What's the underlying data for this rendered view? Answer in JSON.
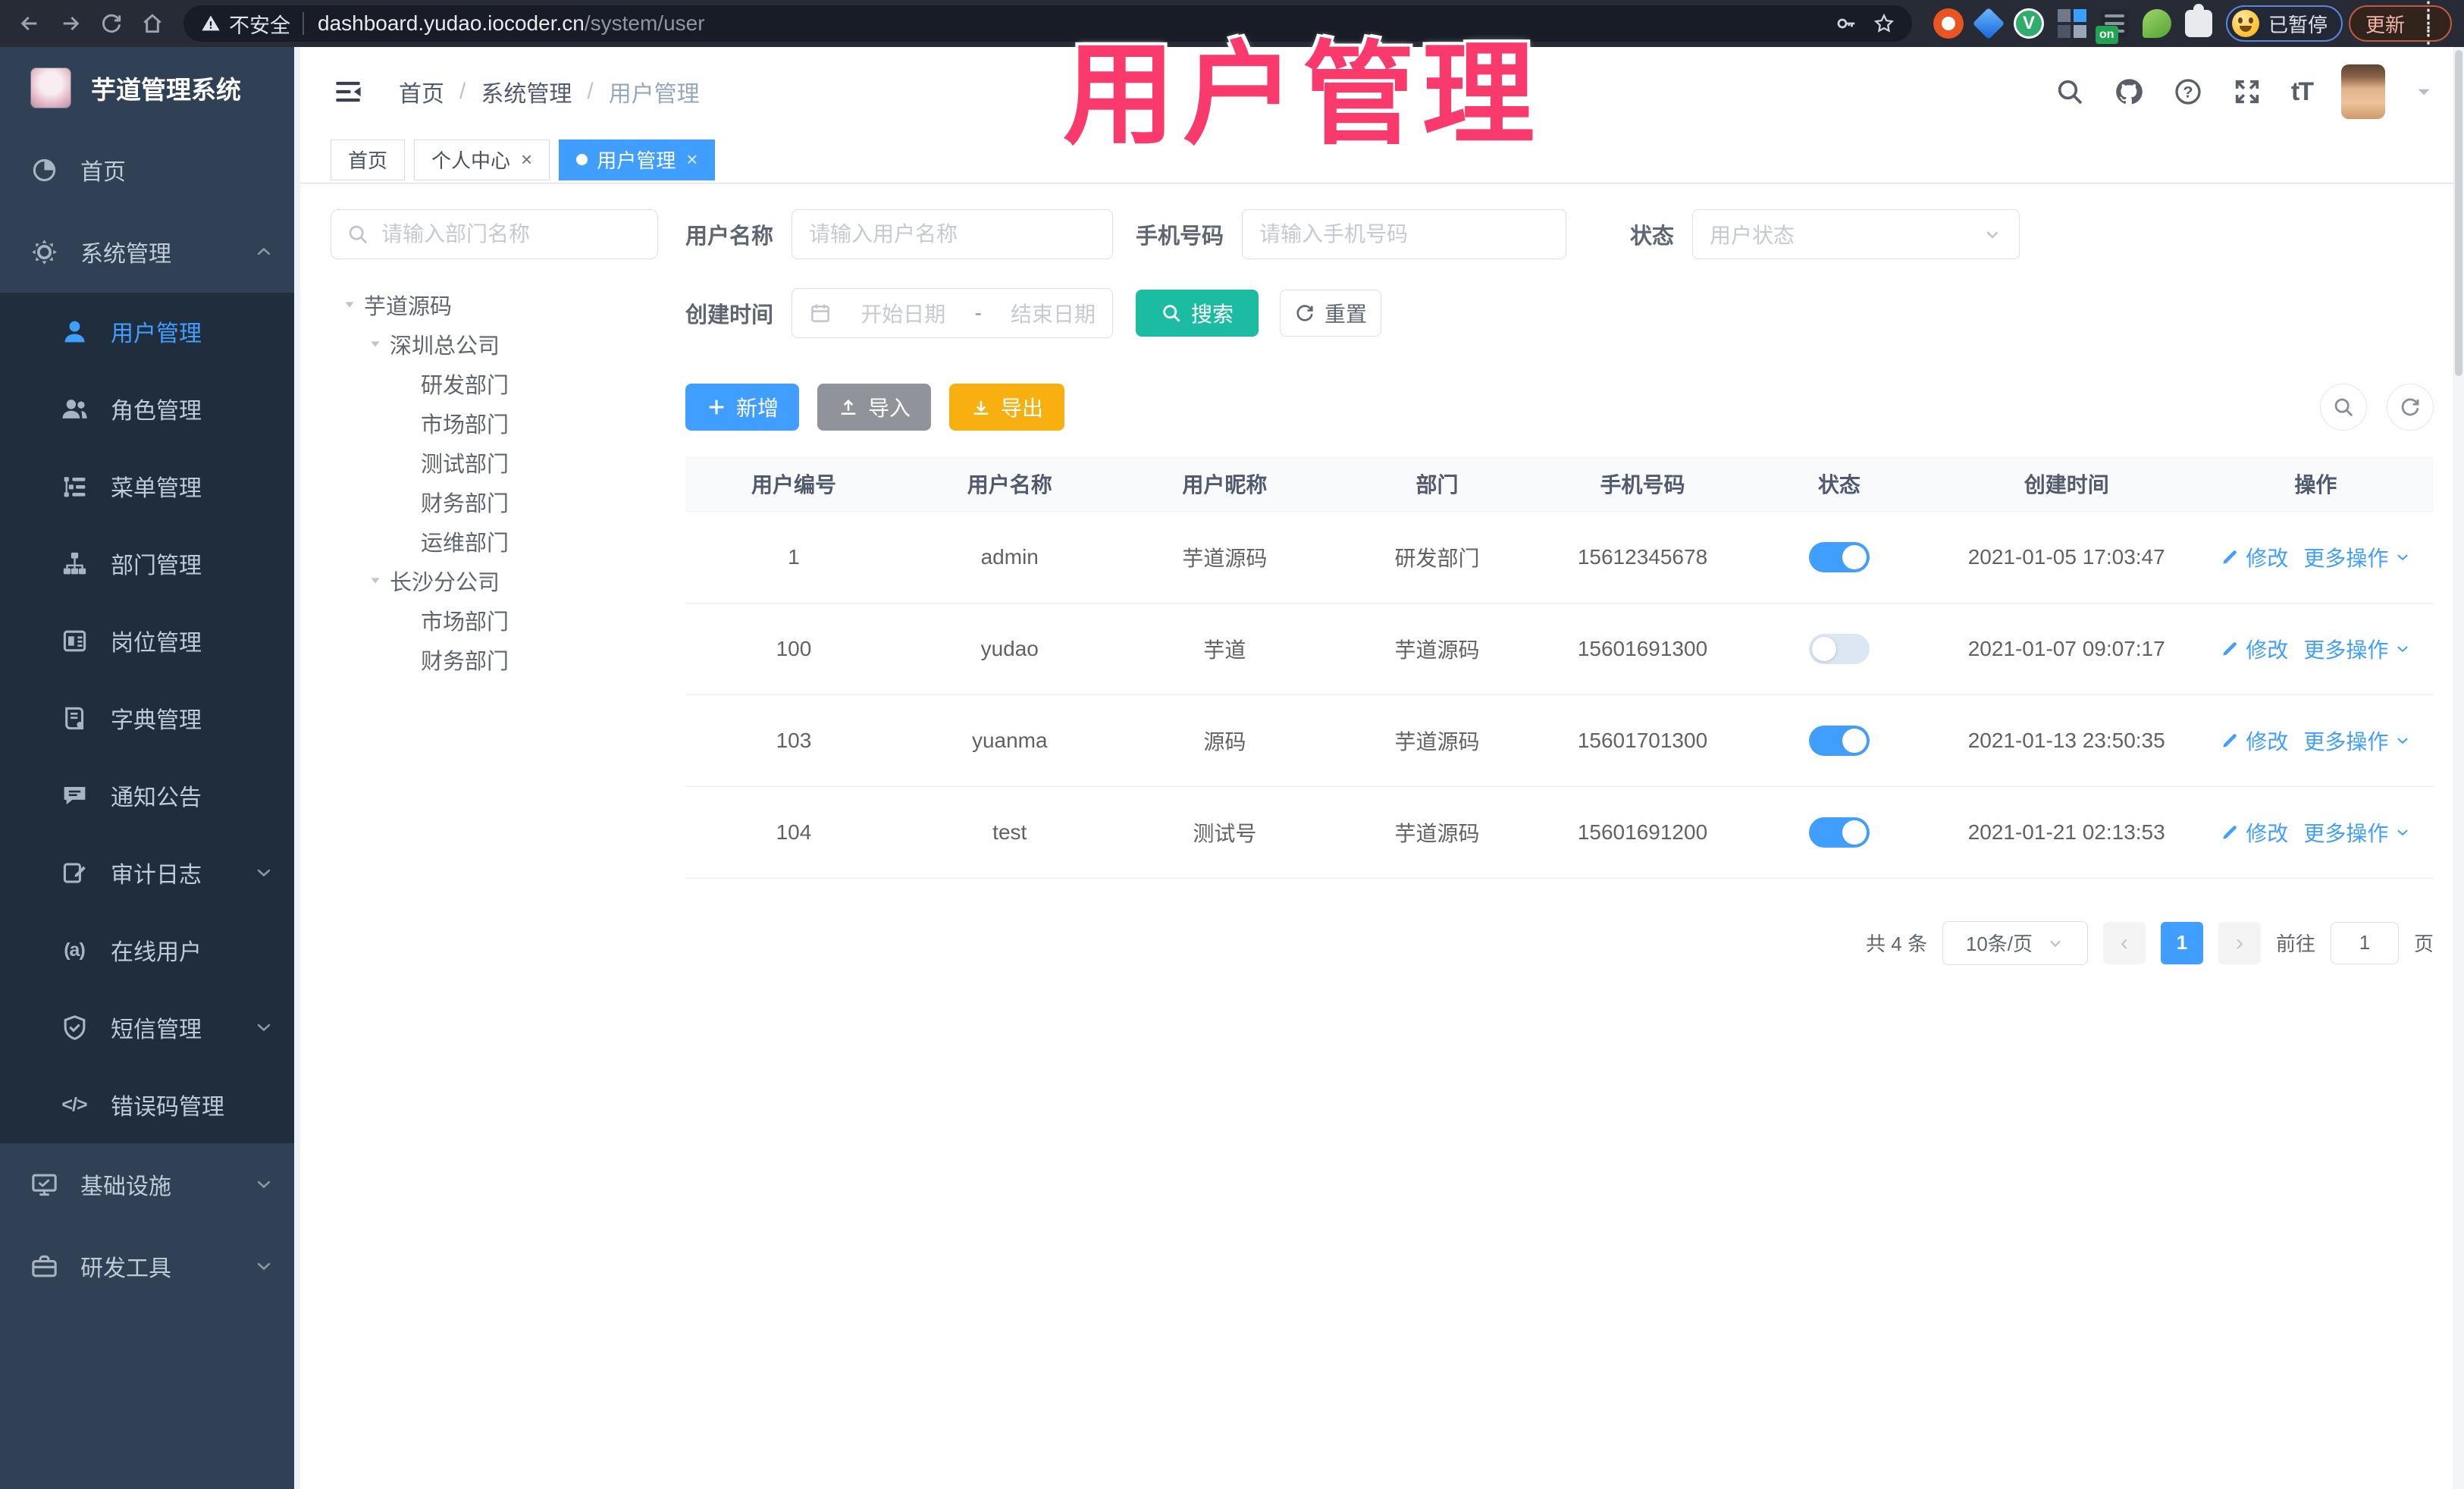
{
  "browser": {
    "security_warning": "不安全",
    "url_host": "dashboard.yudao.iocoder.cn",
    "url_path": "/system/user",
    "vue_badge": "V",
    "on_badge": "on",
    "paused_badge": "已暂停",
    "update_label": "更新"
  },
  "watermark": "用户管理",
  "sidebar": {
    "logo_title": "芋道管理系统",
    "items": [
      {
        "label": "首页",
        "icon": "home-icon",
        "level": "top"
      },
      {
        "label": "系统管理",
        "icon": "gear-icon",
        "level": "top",
        "chevron": "up"
      },
      {
        "label": "用户管理",
        "icon": "user-icon",
        "level": "sub",
        "active": true
      },
      {
        "label": "角色管理",
        "icon": "users-icon",
        "level": "sub"
      },
      {
        "label": "菜单管理",
        "icon": "menu-tree-icon",
        "level": "sub"
      },
      {
        "label": "部门管理",
        "icon": "org-icon",
        "level": "sub"
      },
      {
        "label": "岗位管理",
        "icon": "badge-icon",
        "level": "sub"
      },
      {
        "label": "字典管理",
        "icon": "book-icon",
        "level": "sub"
      },
      {
        "label": "通知公告",
        "icon": "announcement-icon",
        "level": "sub"
      },
      {
        "label": "审计日志",
        "icon": "audit-icon",
        "level": "sub",
        "chevron": "down"
      },
      {
        "label": "在线用户",
        "icon": "online-icon",
        "level": "sub",
        "icon_text": "(a)"
      },
      {
        "label": "短信管理",
        "icon": "sms-icon",
        "level": "sub",
        "chevron": "down"
      },
      {
        "label": "错误码管理",
        "icon": "code-icon",
        "level": "sub",
        "icon_text": "</>"
      },
      {
        "label": "基础设施",
        "icon": "infra-icon",
        "level": "top",
        "chevron": "down"
      },
      {
        "label": "研发工具",
        "icon": "tools-icon",
        "level": "top",
        "chevron": "down"
      }
    ]
  },
  "header": {
    "breadcrumb": [
      "首页",
      "系统管理",
      "用户管理"
    ]
  },
  "tabs": [
    {
      "label": "首页",
      "active": false,
      "closable": false
    },
    {
      "label": "个人中心",
      "active": false,
      "closable": true
    },
    {
      "label": "用户管理",
      "active": true,
      "closable": true
    }
  ],
  "dept_panel": {
    "search_placeholder": "请输入部门名称",
    "tree": [
      {
        "label": "芋道源码",
        "depth": 0,
        "expandable": true
      },
      {
        "label": "深圳总公司",
        "depth": 1,
        "expandable": true
      },
      {
        "label": "研发部门",
        "depth": 2
      },
      {
        "label": "市场部门",
        "depth": 2
      },
      {
        "label": "测试部门",
        "depth": 2
      },
      {
        "label": "财务部门",
        "depth": 2
      },
      {
        "label": "运维部门",
        "depth": 2
      },
      {
        "label": "长沙分公司",
        "depth": 1,
        "expandable": true
      },
      {
        "label": "市场部门",
        "depth": 2
      },
      {
        "label": "财务部门",
        "depth": 2
      }
    ]
  },
  "filters": {
    "username_label": "用户名称",
    "username_placeholder": "请输入用户名称",
    "mobile_label": "手机号码",
    "mobile_placeholder": "请输入手机号码",
    "status_label": "状态",
    "status_placeholder": "用户状态",
    "created_label": "创建时间",
    "date_start_placeholder": "开始日期",
    "date_separator": "-",
    "date_end_placeholder": "结束日期",
    "search_label": "搜索",
    "reset_label": "重置"
  },
  "toolbar": {
    "add_label": "新增",
    "import_label": "导入",
    "export_label": "导出"
  },
  "table": {
    "headers": [
      "用户编号",
      "用户名称",
      "用户昵称",
      "部门",
      "手机号码",
      "状态",
      "创建时间",
      "操作"
    ],
    "rows": [
      {
        "id": "1",
        "username": "admin",
        "nickname": "芋道源码",
        "dept": "研发部门",
        "mobile": "15612345678",
        "status": true,
        "created": "2021-01-05 17:03:47"
      },
      {
        "id": "100",
        "username": "yudao",
        "nickname": "芋道",
        "dept": "芋道源码",
        "mobile": "15601691300",
        "status": false,
        "created": "2021-01-07 09:07:17"
      },
      {
        "id": "103",
        "username": "yuanma",
        "nickname": "源码",
        "dept": "芋道源码",
        "mobile": "15601701300",
        "status": true,
        "created": "2021-01-13 23:50:35"
      },
      {
        "id": "104",
        "username": "test",
        "nickname": "测试号",
        "dept": "芋道源码",
        "mobile": "15601691200",
        "status": true,
        "created": "2021-01-21 02:13:53"
      }
    ],
    "actions": {
      "edit": "修改",
      "more": "更多操作"
    }
  },
  "pagination": {
    "total": "共 4 条",
    "page_size": "10条/页",
    "prev": "‹",
    "next": "›",
    "current": "1",
    "goto": "前往",
    "goto_value": "1",
    "page_unit": "页"
  },
  "colors": {
    "accent": "#409eff",
    "teal": "#1cbca3",
    "warning": "#f7b00f",
    "info": "#909399",
    "annotation_pink": "#fa3a6c",
    "sidebar_bg": "#304156",
    "submenu_bg": "#1f2d3d"
  }
}
